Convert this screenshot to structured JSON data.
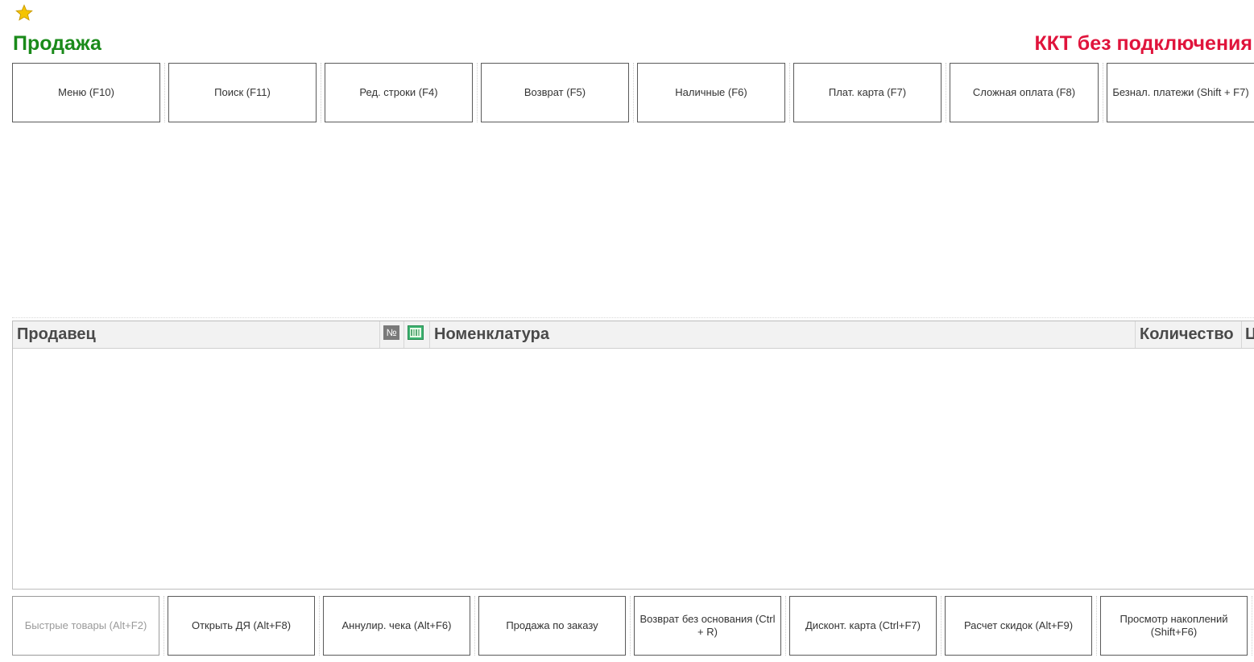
{
  "header": {
    "favorite_icon": "star-icon",
    "title": "Продажа",
    "kkt_status": "ККТ без подключения",
    "colors": {
      "title": "#1a8a1a",
      "kkt_status": "#e0143c",
      "star": "#f5c400"
    }
  },
  "top_toolbar": {
    "buttons": [
      {
        "label": "Меню (F10)"
      },
      {
        "label": "Поиск (F11)"
      },
      {
        "label": "Ред. строки (F4)"
      },
      {
        "label": "Возврат (F5)"
      },
      {
        "label": "Наличные (F6)"
      },
      {
        "label": "Плат. карта (F7)"
      },
      {
        "label": "Сложная оплата (F8)"
      },
      {
        "label": "Безнал. платежи (Shift + F7)"
      }
    ]
  },
  "table": {
    "columns": {
      "seller": "Продавец",
      "number": "№",
      "marking_icon": "marking-icon",
      "nomenclature": "Номенклатура",
      "quantity": "Количество",
      "price_partial": "Ц"
    },
    "rows": []
  },
  "bottom_toolbar": {
    "buttons": [
      {
        "label": "Быстрые товары (Alt+F2)",
        "disabled": true
      },
      {
        "label": "Открыть ДЯ (Alt+F8)"
      },
      {
        "label": "Аннулир. чека (Alt+F6)"
      },
      {
        "label": "Продажа по заказу"
      },
      {
        "label": "Возврат без основания (Ctrl + R)"
      },
      {
        "label": "Дисконт. карта (Ctrl+F7)"
      },
      {
        "label": "Расчет скидок (Alt+F9)"
      },
      {
        "label": "Просмотр накоплений (Shift+F6)"
      }
    ]
  }
}
